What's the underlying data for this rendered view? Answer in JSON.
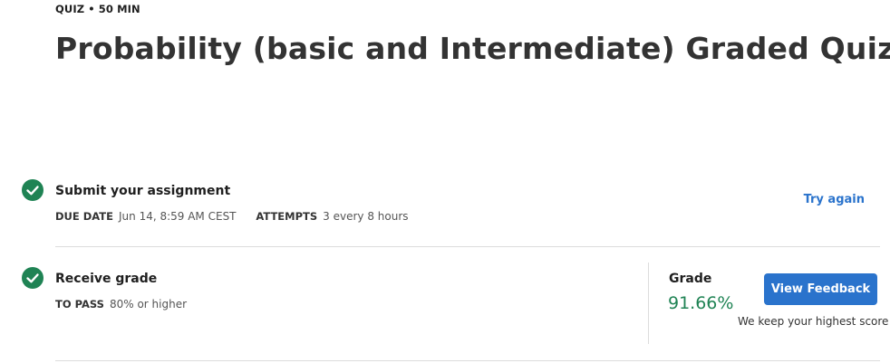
{
  "header": {
    "meta": "QUIZ • 50 MIN",
    "title": "Probability (basic and Intermediate) Graded Quiz"
  },
  "steps": [
    {
      "icon": "check-circle-icon",
      "title": "Submit your assignment",
      "fields": [
        {
          "label": "DUE DATE",
          "value": "Jun 14, 8:59 AM CEST"
        },
        {
          "label": "ATTEMPTS",
          "value": "3 every 8 hours"
        }
      ],
      "action_label": "Try again"
    },
    {
      "icon": "check-circle-icon",
      "title": "Receive grade",
      "fields": [
        {
          "label": "TO PASS",
          "value": "80% or higher"
        }
      ],
      "grade": {
        "label": "Grade",
        "value": "91.66%",
        "button_label": "View Feedback",
        "note": "We keep your highest score"
      }
    }
  ],
  "colors": {
    "success": "#1f8354",
    "accent": "#2a73cc",
    "divider": "#dcdcdc"
  }
}
